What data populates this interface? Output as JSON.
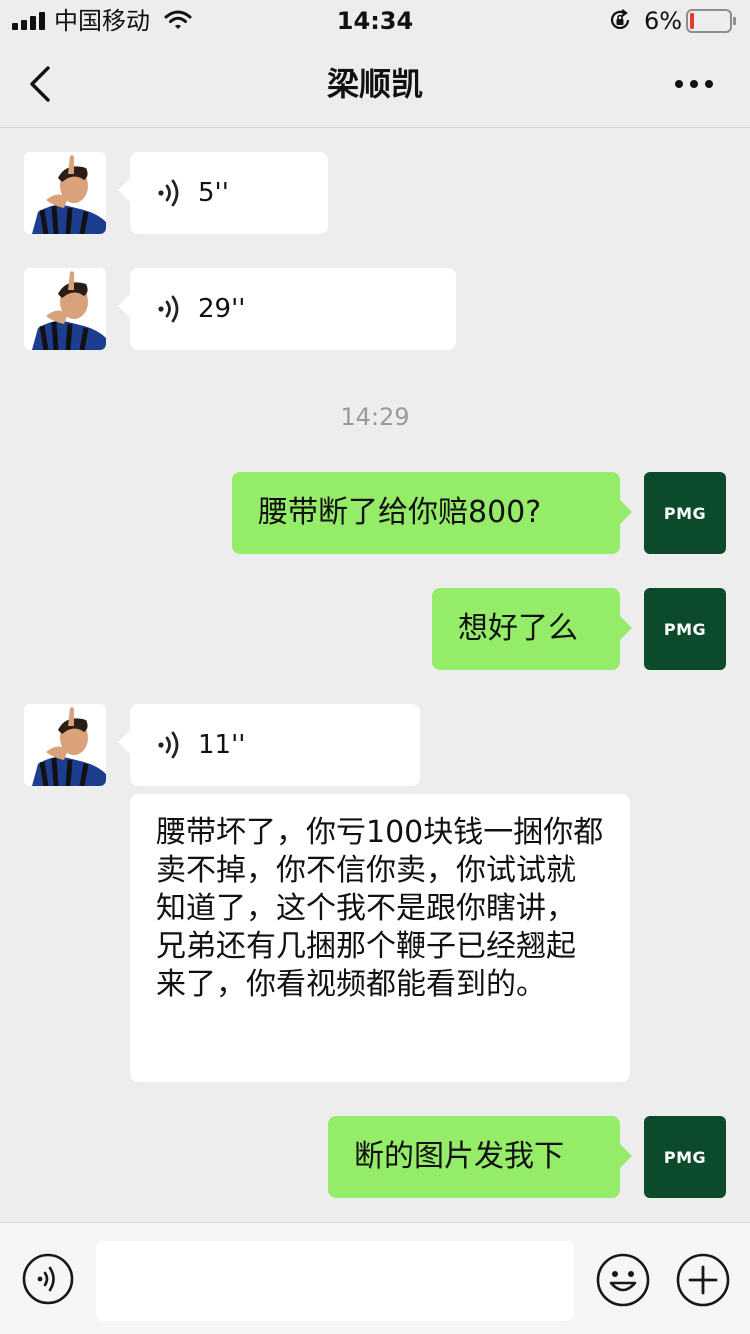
{
  "status_bar": {
    "carrier": "中国移动",
    "time": "14:34",
    "battery_percent": "6%"
  },
  "nav": {
    "title": "梁顺凯",
    "back_icon": "chevron-left-icon",
    "more_icon": "more-dots-icon"
  },
  "contacts": {
    "self_avatar_text": "PMG"
  },
  "messages": [
    {
      "type": "voice",
      "direction": "in",
      "duration": "5''"
    },
    {
      "type": "voice",
      "direction": "in",
      "duration": "29''"
    },
    {
      "type": "timestamp",
      "text": "14:29"
    },
    {
      "type": "text",
      "direction": "out",
      "text": "腰带断了给你赔800?"
    },
    {
      "type": "text",
      "direction": "out",
      "text": "想好了么"
    },
    {
      "type": "voice",
      "direction": "in",
      "duration": "11''"
    },
    {
      "type": "text",
      "direction": "in",
      "text": "腰带坏了，你亏100块钱一捆你都卖不掉，你不信你卖，你试试就知道了，这个我不是跟你瞎讲，兄弟还有几捆那个鞭子已经翘起来了，你看视频都能看到的。"
    },
    {
      "type": "text",
      "direction": "out",
      "text": "断的图片发我下"
    }
  ],
  "input_bar": {
    "placeholder": "",
    "voice_icon": "voice-input-icon",
    "emoji_icon": "emoji-icon",
    "plus_icon": "plus-icon"
  },
  "colors": {
    "background": "#ededed",
    "outgoing_bubble": "#95ec69",
    "incoming_bubble": "#ffffff",
    "self_avatar": "#0b4a2a",
    "battery_low": "#e8392f"
  }
}
